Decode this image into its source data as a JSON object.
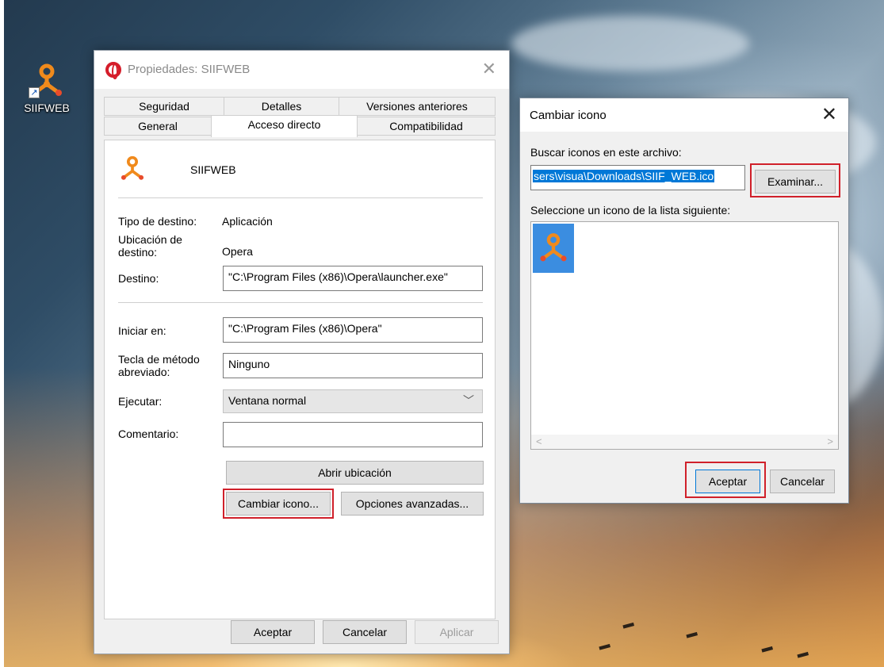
{
  "desktop": {
    "icon_label": "SIIFWEB"
  },
  "properties": {
    "title": "Propiedades: SIIFWEB",
    "tabs_row1": [
      "Seguridad",
      "Detalles",
      "Versiones anteriores"
    ],
    "tabs_row2": [
      "General",
      "Acceso directo",
      "Compatibilidad"
    ],
    "name": "SIIFWEB",
    "tipo_label": "Tipo de destino:",
    "tipo_value": "Aplicación",
    "ubicacion_label": "Ubicación de destino:",
    "ubicacion_value": "Opera",
    "destino_label": "Destino:",
    "destino_value": "\"C:\\Program Files (x86)\\Opera\\launcher.exe\"",
    "iniciar_label": "Iniciar en:",
    "iniciar_value": "\"C:\\Program Files (x86)\\Opera\"",
    "tecla_label": "Tecla de método abreviado:",
    "tecla_value": "Ninguno",
    "ejecutar_label": "Ejecutar:",
    "ejecutar_value": "Ventana normal",
    "comentario_label": "Comentario:",
    "comentario_value": "",
    "abrir_ubicacion": "Abrir ubicación",
    "cambiar_icono": "Cambiar icono...",
    "opciones_avanzadas": "Opciones avanzadas...",
    "aceptar": "Aceptar",
    "cancelar": "Cancelar",
    "aplicar": "Aplicar"
  },
  "change_icon": {
    "title": "Cambiar icono",
    "buscar_label": "Buscar iconos en este archivo:",
    "path_value": "sers\\visua\\Downloads\\SIIF_WEB.ico",
    "examinar": "Examinar...",
    "seleccione_label": "Seleccione un icono de la lista siguiente:",
    "aceptar": "Aceptar",
    "cancelar": "Cancelar"
  },
  "colors": {
    "highlight": "#d0202a",
    "accent": "#0078d7",
    "icon_orange": "#f08a1c"
  }
}
